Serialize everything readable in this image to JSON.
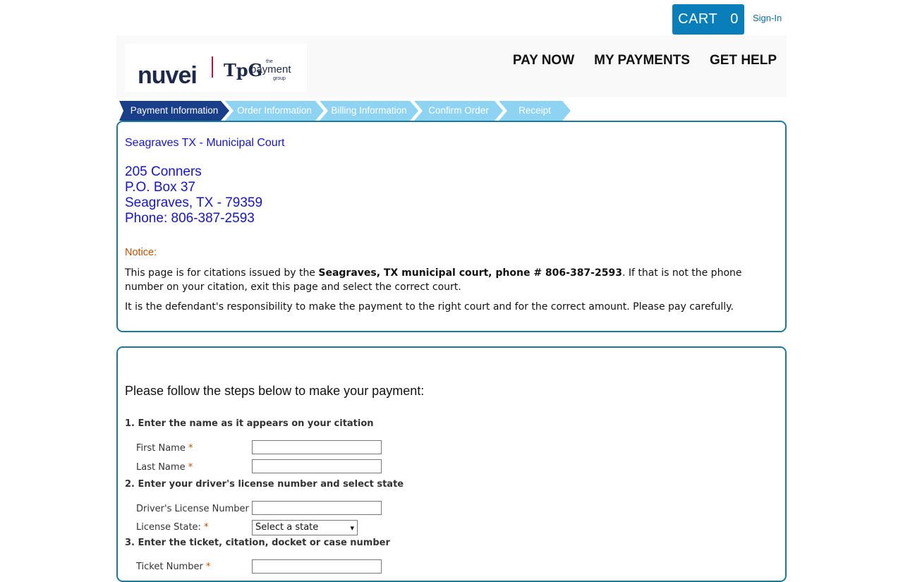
{
  "topbar": {
    "cart_label": "CART",
    "cart_count": "0",
    "signin_label": "Sign-In"
  },
  "header": {
    "logo_nuvei": "nuvei",
    "logo_tpg_the": "the",
    "logo_tpg_payment": "payment",
    "logo_tpg_group": "group",
    "nav": [
      "PAY NOW",
      "MY PAYMENTS",
      "GET HELP"
    ]
  },
  "steps": [
    {
      "label": "Payment Information",
      "active": true
    },
    {
      "label": "Order Information",
      "active": false
    },
    {
      "label": "Billing Information",
      "active": false
    },
    {
      "label": "Confirm Order",
      "active": false
    },
    {
      "label": "Receipt",
      "active": false
    }
  ],
  "court": {
    "name": "Seagraves TX - Municipal Court",
    "address_line1": "205 Conners",
    "address_line2": "P.O. Box 37",
    "address_line3": "Seagraves, TX - 79359",
    "phone": "Phone: 806-387-2593"
  },
  "notice": {
    "label": "Notice:",
    "p1_before": "This page is for citations issued by the ",
    "p1_bold": "Seagraves, TX municipal court, phone # 806-387-2593",
    "p1_after": ". If that is not the phone number on your citation, exit this page and select the correct court.",
    "p2": "It is the defendant's responsibility to make the payment to the right court and for the correct amount. Please pay carefully."
  },
  "form": {
    "heading": "Please follow the steps below to make your payment:",
    "section1": "1. Enter the name as it appears on your citation",
    "first_name_label": "First Name",
    "last_name_label": "Last Name",
    "section2": "2. Enter your driver's license number and select state",
    "dl_label": "Driver's License Number",
    "state_label": "License State:",
    "state_selected": "Select a state",
    "section3": "3. Enter the ticket, citation, docket or case number",
    "ticket_label": "Ticket Number",
    "required_mark": "*"
  }
}
